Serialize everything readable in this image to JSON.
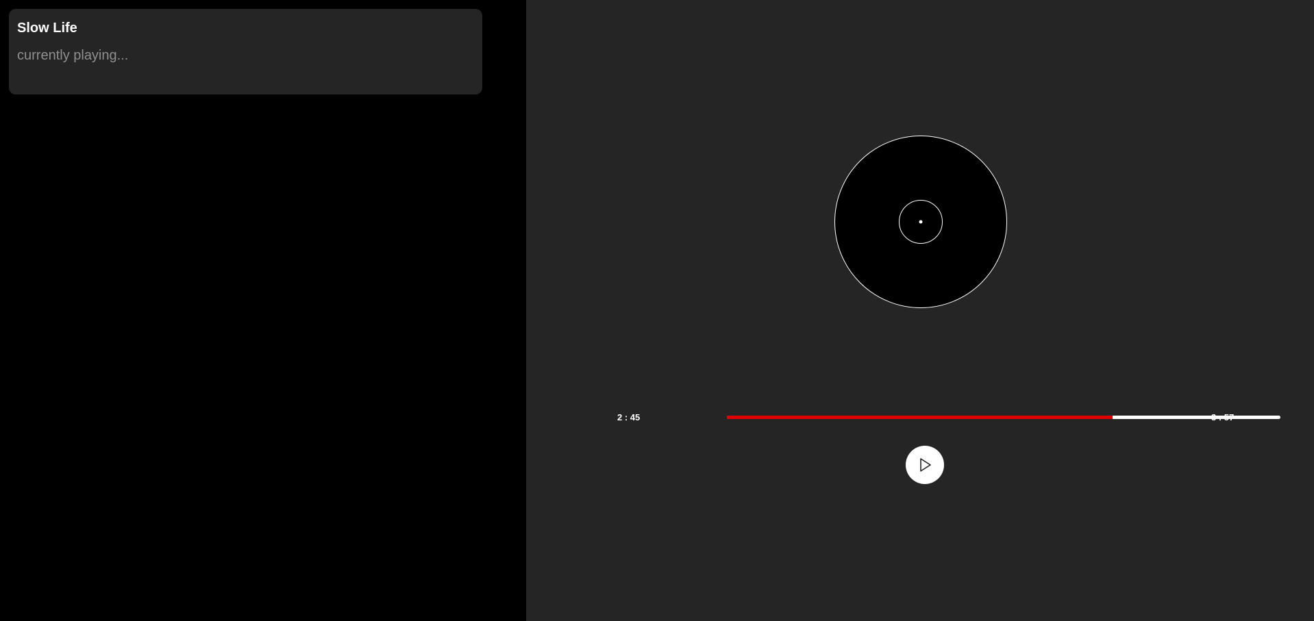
{
  "sidebar": {
    "track_title": "Slow Life",
    "track_status": "currently playing..."
  },
  "player": {
    "current_time": "2 : 45",
    "total_time": "3 : 57",
    "progress_fraction": 0.697,
    "play_icon": "play-icon",
    "vinyl_icon": "vinyl-record-icon"
  },
  "colors": {
    "sidebar_bg": "#000000",
    "card_bg": "#252525",
    "player_bg": "#252525",
    "progress_played": "#e00000",
    "progress_remaining": "#ffffff",
    "status_text": "#8f8f8f"
  }
}
